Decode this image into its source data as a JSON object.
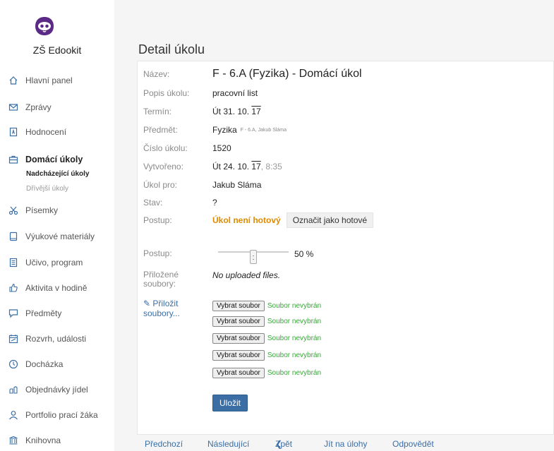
{
  "sidebar": {
    "school_name": "ZŠ Edookit",
    "items": [
      {
        "label": "Hlavní panel",
        "icon": "home-icon"
      },
      {
        "label": "Zprávy",
        "icon": "envelope-icon"
      },
      {
        "label": "Hodnocení",
        "icon": "grade-icon"
      },
      {
        "label": "Domácí úkoly",
        "icon": "briefcase-icon"
      },
      {
        "label": "Písemky",
        "icon": "scissors-icon"
      },
      {
        "label": "Výukové materiály",
        "icon": "book-icon"
      },
      {
        "label": "Učivo, program",
        "icon": "document-icon"
      },
      {
        "label": "Aktivita v hodině",
        "icon": "thumbs-up-icon"
      },
      {
        "label": "Předměty",
        "icon": "chat-icon"
      },
      {
        "label": "Rozvrh, události",
        "icon": "calendar-icon"
      },
      {
        "label": "Docházka",
        "icon": "clock-icon"
      },
      {
        "label": "Objednávky jídel",
        "icon": "food-icon"
      },
      {
        "label": "Portfolio prací žáka",
        "icon": "user-icon"
      },
      {
        "label": "Knihovna",
        "icon": "library-icon"
      }
    ],
    "subitems": {
      "current": "Nadcházející úkoly",
      "other": "Dřívější úkoly"
    }
  },
  "main": {
    "page_title": "Detail úkolu",
    "fields": {
      "nazev_label": "Název:",
      "nazev_value": "F - 6.A (Fyzika) - Domácí úkol",
      "popis_label": "Popis úkolu:",
      "popis_value": "pracovní list",
      "termin_label": "Termín:",
      "termin_value_prefix": "Út 31. 10. ",
      "termin_value_year": "17",
      "predmet_label": "Předmět:",
      "predmet_value": "Fyzika",
      "predmet_meta": "F - 6.A, Jakub Sláma",
      "cislo_label": "Číslo úkolu:",
      "cislo_value": "1520",
      "vytvoreno_label": "Vytvořeno:",
      "vytvoreno_value_prefix": "Út 24. 10. ",
      "vytvoreno_value_year": "17",
      "vytvoreno_time": ", 8:35",
      "ukol_pro_label": "Úkol pro:",
      "ukol_pro_value": "Jakub Sláma",
      "stav_label": "Stav:",
      "stav_value": "?",
      "postup_label": "Postup:",
      "postup_status": "Úkol není hotový",
      "mark_done_label": "Označit jako hotové",
      "postup2_label": "Postup:",
      "progress_percent": 50,
      "progress_text": "50 %",
      "prilozene_label": "Přiložené soubory:",
      "prilozene_value": "No uploaded files."
    },
    "attach_link": "Přiložit soubory...",
    "file_inputs": [
      {
        "button": "Vybrat soubor",
        "status": "Soubor nevybrán"
      },
      {
        "button": "Vybrat soubor",
        "status": "Soubor nevybrán"
      },
      {
        "button": "Vybrat soubor",
        "status": "Soubor nevybrán"
      },
      {
        "button": "Vybrat soubor",
        "status": "Soubor nevybrán"
      },
      {
        "button": "Vybrat soubor",
        "status": "Soubor nevybrán"
      }
    ],
    "save_label": "Uložit",
    "footer": {
      "prev": "Předchozí",
      "next": "Následující",
      "back": "Zpět",
      "back_glyph": "❮",
      "go_tasks": "Jít na úlohy",
      "reply": "Odpovědět"
    }
  },
  "colors": {
    "accent": "#3a6ea5",
    "warning": "#e08a00",
    "success": "#3aa53a",
    "main_bg": "#f5f5f5"
  }
}
